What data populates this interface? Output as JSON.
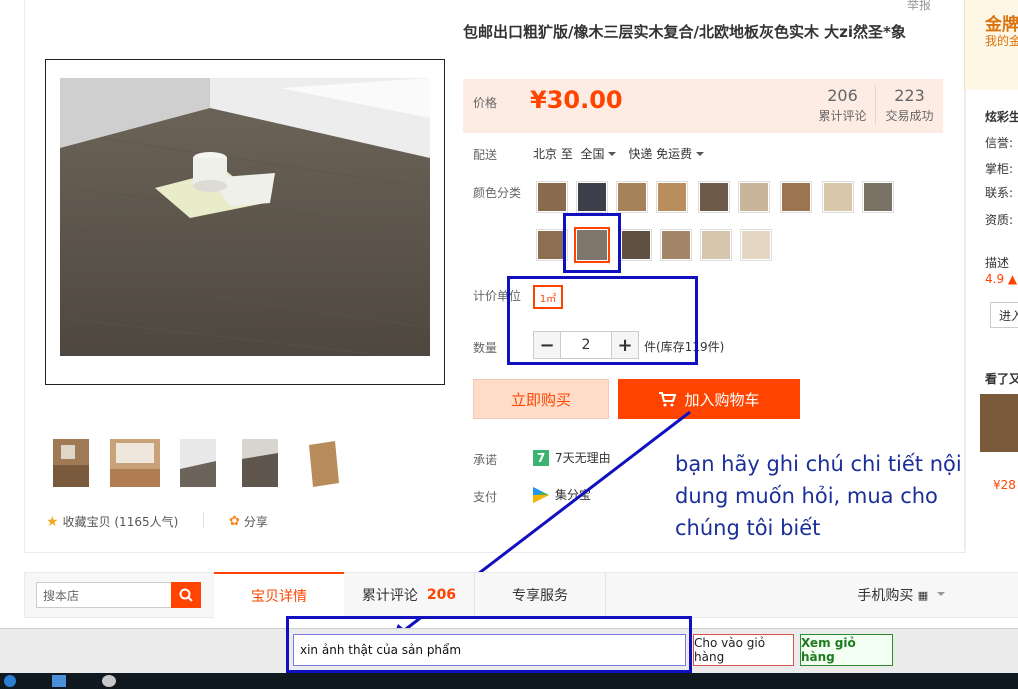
{
  "header": {
    "report": "举报"
  },
  "product": {
    "title": "包邮出口粗犷版/橡木三层实木复合/北欧地板灰色实木 大zi然圣*象",
    "price_label": "价格",
    "currency": "¥",
    "price": "30.00",
    "reviews_count": "206",
    "reviews_label": "累计评论",
    "sales_count": "223",
    "sales_label": "交易成功",
    "delivery_label": "配送",
    "delivery_from": "北京 至",
    "delivery_to": "全国",
    "delivery_method": "快递 免运费",
    "color_label": "颜色分类",
    "unit_label": "计价单位",
    "unit_value": "1㎡",
    "qty_label": "数量",
    "qty_minus": "−",
    "qty_value": "2",
    "qty_plus": "+",
    "stock": "件(库存119件)",
    "buy_now": "立即购买",
    "add_to_cart": "加入购物车",
    "promise_label": "承诺",
    "promise_value": "7天无理由",
    "promise_badge": "7",
    "pay_label": "支付",
    "pay_value": "集分宝",
    "favorite": "收藏宝贝 (1165人气)",
    "share": "分享"
  },
  "annotation": {
    "note": "bạn hãy ghi chú chi tiết nội dung muốn hỏi, mua cho chúng tôi biết"
  },
  "sidebar": {
    "brand_title": "金牌",
    "brand_sub": "我的金",
    "shop_name": "炫彩生",
    "lines": [
      "信誉:",
      "掌柜:",
      "联系:",
      "资质:"
    ],
    "desc_label": "描述",
    "desc_score": "4.9",
    "enter_btn": "进入",
    "look_title": "看了又",
    "look_price": "¥28"
  },
  "tabs": {
    "search_placeholder": "搜本店",
    "detail": "宝贝详情",
    "reviews": "累计评论",
    "reviews_count": "206",
    "service": "专享服务",
    "mobile": "手机购买"
  },
  "chat": {
    "input_value": "xin ảnh thật của sản phẩm",
    "add_cart": "Cho vào giỏ hàng",
    "view_cart": "Xem giỏ hàng"
  },
  "colors": {
    "accent": "#ff4400",
    "annotation_blue": "#1010c0",
    "note_text": "#1a2f99",
    "price_bg": "#fdece3"
  }
}
